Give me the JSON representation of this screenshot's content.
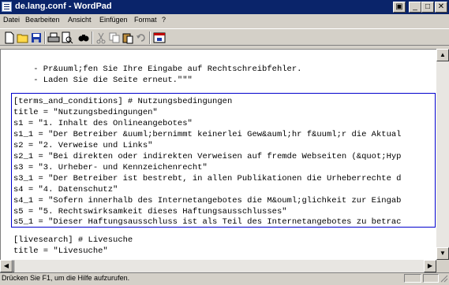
{
  "window": {
    "title": "de.lang.conf - WordPad"
  },
  "menu": [
    "Datei",
    "Bearbeiten",
    "Ansicht",
    "Einfügen",
    "Format",
    "?"
  ],
  "toolbar_icons": [
    "new-document-icon",
    "open-folder-icon",
    "save-icon",
    "print-icon",
    "print-preview-icon",
    "find-icon",
    "cut-icon",
    "copy-icon",
    "paste-icon",
    "undo-icon",
    "insert-date-icon"
  ],
  "editor": {
    "lines": [
      "",
      "    - Pr&uuml;fen Sie Ihre Eingabe auf Rechtschreibfehler.",
      "    - Laden Sie die Seite erneut.\"\"\"",
      "",
      "[terms_and_conditions] # Nutzungsbedingungen",
      "title = \"Nutzungsbedingungen\"",
      "s1 = \"1. Inhalt des Onlineangebotes\"",
      "s1_1 = \"Der Betreiber &uuml;bernimmt keinerlei Gew&auml;hr f&uuml;r die Aktual",
      "s2 = \"2. Verweise und Links\"",
      "s2_1 = \"Bei direkten oder indirekten Verweisen auf fremde Webseiten (&quot;Hyp",
      "s3 = \"3. Urheber- und Kennzeichenrecht\"",
      "s3_1 = \"Der Betreiber ist bestrebt, in allen Publikationen die Urheberrechte d",
      "s4 = \"4. Datenschutz\"",
      "s4_1 = \"Sofern innerhalb des Internetangebotes die M&ouml;glichkeit zur Eingab",
      "s5 = \"5. Rechtswirksamkeit dieses Haftungsausschlusses\"",
      "s5_1 = \"Dieser Haftungsausschluss ist als Teil des Internetangebotes zu betrac",
      "",
      "[livesearch] # Livesuche",
      "title = \"Livesuche\""
    ]
  },
  "status": {
    "text": "Drücken Sie F1, um die Hilfe aufzurufen."
  },
  "colors": {
    "titlebar": "#0a246a",
    "selection_border": "#0000cc",
    "chrome": "#d4d0c8"
  }
}
